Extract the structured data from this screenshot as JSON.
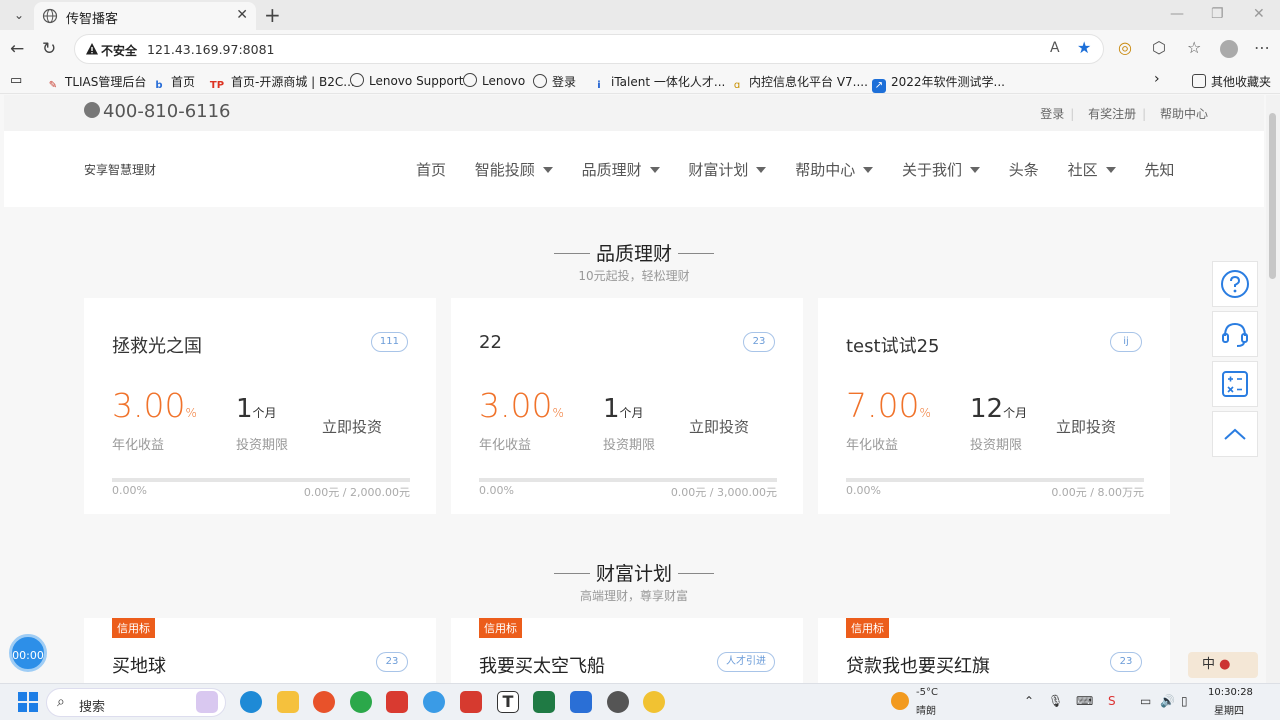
{
  "browser": {
    "tab_title": "传智播客",
    "not_secure": "不安全",
    "url": "121.43.169.97:8081",
    "bookmarks": [
      "TLIAS管理后台",
      "首页",
      "首页-开源商城 | B2C...",
      "Lenovo Support",
      "Lenovo",
      "登录",
      "iTalent 一体化人才...",
      "内控信息化平台 V7....",
      "2022年软件测试学..."
    ],
    "other_bookmarks": "其他收藏夹"
  },
  "site": {
    "phone": "400-810-6116",
    "top_links": [
      "登录",
      "有奖注册",
      "帮助中心"
    ],
    "brand": "安享智慧理财",
    "nav": [
      {
        "label": "首页",
        "dropdown": false
      },
      {
        "label": "智能投顾",
        "dropdown": true
      },
      {
        "label": "品质理财",
        "dropdown": true
      },
      {
        "label": "财富计划",
        "dropdown": true
      },
      {
        "label": "帮助中心",
        "dropdown": true
      },
      {
        "label": "关于我们",
        "dropdown": true
      },
      {
        "label": "头条",
        "dropdown": false
      },
      {
        "label": "社区",
        "dropdown": true
      },
      {
        "label": "先知",
        "dropdown": false
      }
    ]
  },
  "quality": {
    "title": "品质理财",
    "subtitle": "10元起投，轻松理财",
    "rate_label": "年化收益",
    "term_label": "投资期限",
    "invest_label": "立即投资",
    "products": [
      {
        "name": "拯救光之国",
        "badge": "111",
        "rate": "3.00",
        "rate_unit": "%",
        "term": "1",
        "term_unit": "个月",
        "progress": "0.00%",
        "amount": "0.00元 / 2,000.00元",
        "progress_value": 0
      },
      {
        "name": "22",
        "badge": "23",
        "rate": "3.00",
        "rate_unit": "%",
        "term": "1",
        "term_unit": "个月",
        "progress": "0.00%",
        "amount": "0.00元 / 3,000.00元",
        "progress_value": 0
      },
      {
        "name": "test试试25",
        "badge": "ij",
        "rate": "7.00",
        "rate_unit": "%",
        "term": "12",
        "term_unit": "个月",
        "progress": "0.00%",
        "amount": "0.00元 / 8.00万元",
        "progress_value": 0
      }
    ]
  },
  "wealth": {
    "title": "财富计划",
    "subtitle": "高端理财，尊享财富",
    "tag": "信用标",
    "plans": [
      {
        "name": "买地球",
        "badge": "23"
      },
      {
        "name": "我要买太空飞船",
        "badge": "人才引进"
      },
      {
        "name": "贷款我也要买红旗",
        "badge": "23"
      }
    ]
  },
  "overlay": {
    "timer": "00:00",
    "ime": "中"
  },
  "taskbar": {
    "search": "搜索",
    "temp": "-5°C",
    "weather": "晴朗",
    "time": "10:30:28",
    "weekday": "星期四"
  }
}
